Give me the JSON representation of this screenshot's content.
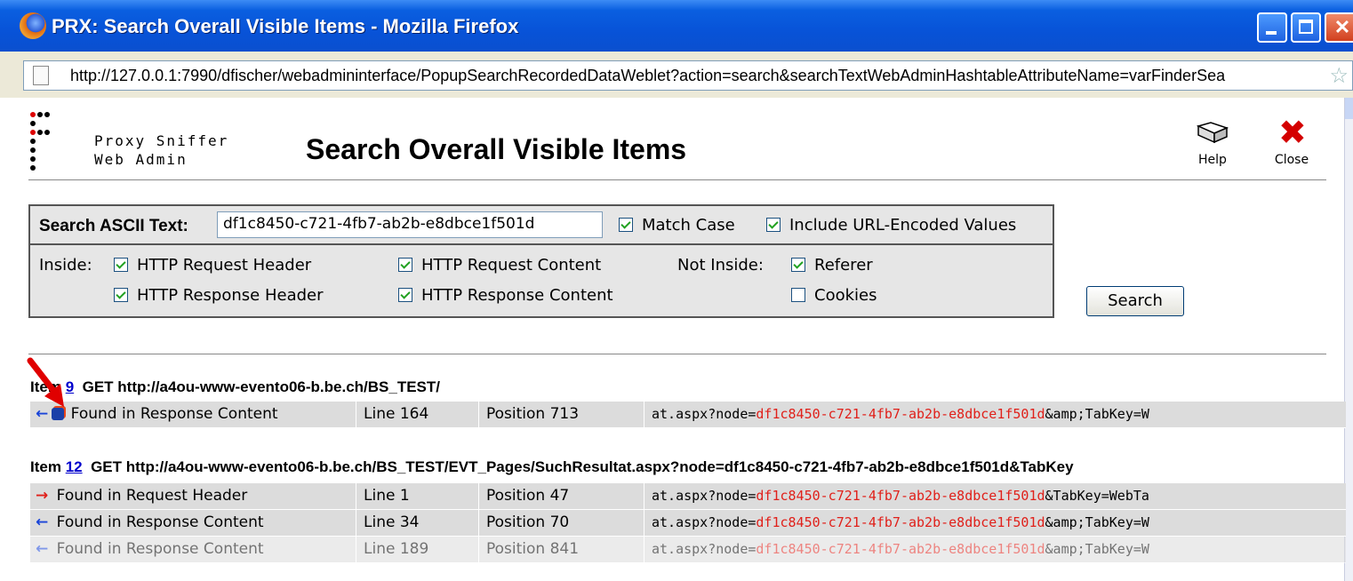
{
  "window": {
    "title": "PRX: Search Overall Visible Items - Mozilla Firefox",
    "url": "http://127.0.0.1:7990/dfischer/webadmininterface/PopupSearchRecordedDataWeblet?action=search&searchTextWebAdminHashtableAttributeName=varFinderSea"
  },
  "header": {
    "brand_line1": "Proxy Sniffer",
    "brand_line2": "Web Admin",
    "title": "Search Overall Visible Items",
    "help_label": "Help",
    "close_label": "Close",
    "help_icon": "book-icon",
    "close_icon": "red-x-icon"
  },
  "search": {
    "label": "Search ASCII Text:",
    "value": "df1c8450-c721-4fb7-ab2b-e8dbce1f501d",
    "match_case": {
      "label": "Match Case",
      "checked": true
    },
    "include_url_encoded": {
      "label": "Include URL-Encoded Values",
      "checked": true
    },
    "inside_label": "Inside:",
    "not_inside_label": "Not Inside:",
    "inside": [
      {
        "label": "HTTP Request Header",
        "checked": true
      },
      {
        "label": "HTTP Request Content",
        "checked": true
      },
      {
        "label": "HTTP Response Header",
        "checked": true
      },
      {
        "label": "HTTP Response Content",
        "checked": true
      }
    ],
    "not_inside": [
      {
        "label": "Referer",
        "checked": true
      },
      {
        "label": "Cookies",
        "checked": false
      }
    ],
    "button_label": "Search"
  },
  "results": [
    {
      "item_prefix": "Item",
      "item_number": "9",
      "request": "GET http://a4ou-www-evento06-b.be.ch/BS_TEST/",
      "rows": [
        {
          "direction": "left",
          "found": "Found in Response Content",
          "line": "Line 164",
          "position": "Position 713",
          "snippet_pre": "at.aspx?node=",
          "snippet_hit": "df1c8450-c721-4fb7-ab2b-e8dbce1f501d",
          "snippet_post": "&amp;TabKey=W"
        }
      ]
    },
    {
      "item_prefix": "Item",
      "item_number": "12",
      "request": "GET http://a4ou-www-evento06-b.be.ch/BS_TEST/EVT_Pages/SuchResultat.aspx?node=df1c8450-c721-4fb7-ab2b-e8dbce1f501d&TabKey",
      "rows": [
        {
          "direction": "right",
          "found": "Found in Request Header",
          "line": "Line 1",
          "position": "Position 47",
          "snippet_pre": "at.aspx?node=",
          "snippet_hit": "df1c8450-c721-4fb7-ab2b-e8dbce1f501d",
          "snippet_post": "&TabKey=WebTa"
        },
        {
          "direction": "left",
          "found": "Found in Response Content",
          "line": "Line 34",
          "position": "Position 70",
          "snippet_pre": "at.aspx?node=",
          "snippet_hit": "df1c8450-c721-4fb7-ab2b-e8dbce1f501d",
          "snippet_post": "&amp;TabKey=W"
        },
        {
          "direction": "left",
          "found": "Found in Response Content",
          "line": "Line 189",
          "position": "Position 841",
          "snippet_pre": "at.aspx?node=",
          "snippet_hit": "df1c8450-c721-4fb7-ab2b-e8dbce1f501d",
          "snippet_post": "&amp;TabKey=W"
        }
      ]
    }
  ],
  "colors": {
    "highlight": "#e0201a",
    "titlebar": "#0853d8",
    "row_bg": "#dcdcdc"
  }
}
